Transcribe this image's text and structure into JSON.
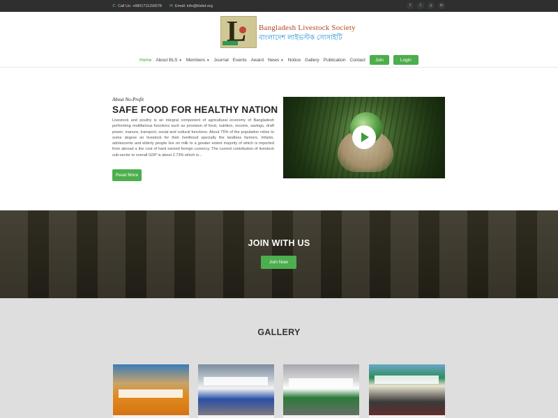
{
  "topbar": {
    "phone": "Call Us: +8801711156578",
    "email": "Email: info@blsbd.org",
    "social": [
      "f",
      "t",
      "y",
      "in"
    ],
    "icons": [
      "phone-icon",
      "envelope-icon",
      "facebook-icon",
      "twitter-icon",
      "youtube-icon",
      "linkedin-icon"
    ]
  },
  "logo": {
    "name_en": "Bangladesh Livestock Society",
    "name_bn": "বাংলাদেশ লাইভস্টক সোসাইটি",
    "letter": "L"
  },
  "nav": {
    "items": [
      "Home",
      "About BLS",
      "Members",
      "Journal",
      "Events",
      "Award",
      "News",
      "Notice",
      "Gallery",
      "Publication",
      "Contact"
    ],
    "active": "Home",
    "join_label": "Join",
    "login_label": "Login"
  },
  "about": {
    "label": "About No-Profit",
    "title": "SAFE FOOD FOR HEALTHY NATION",
    "text": "Livestock and poultry is an integral component of agricultural economy of Bangladesh performing multifarious functions such as provision of food, nutrition, income, savings, draft power, manure, transport, social and cultural functions. About 75% of the population relies to some degree on livestock for their livelihood specially the landless farmers. Infants, adolescents and elderly people live on milk to a greater extent majority of which is imported from abroad a the cost of hard earned foreign currency. The current contribution of livestock sub-sector to overall GDP is about 2.73% which is...",
    "button": "Read More"
  },
  "join": {
    "title": "JOIN WITH US",
    "button": "Join Now"
  },
  "gallery": {
    "title": "GALLERY"
  },
  "colors": {
    "accent": "#4cae4c",
    "topbar": "#2f2f2f",
    "gallery_bg": "#dedede"
  }
}
